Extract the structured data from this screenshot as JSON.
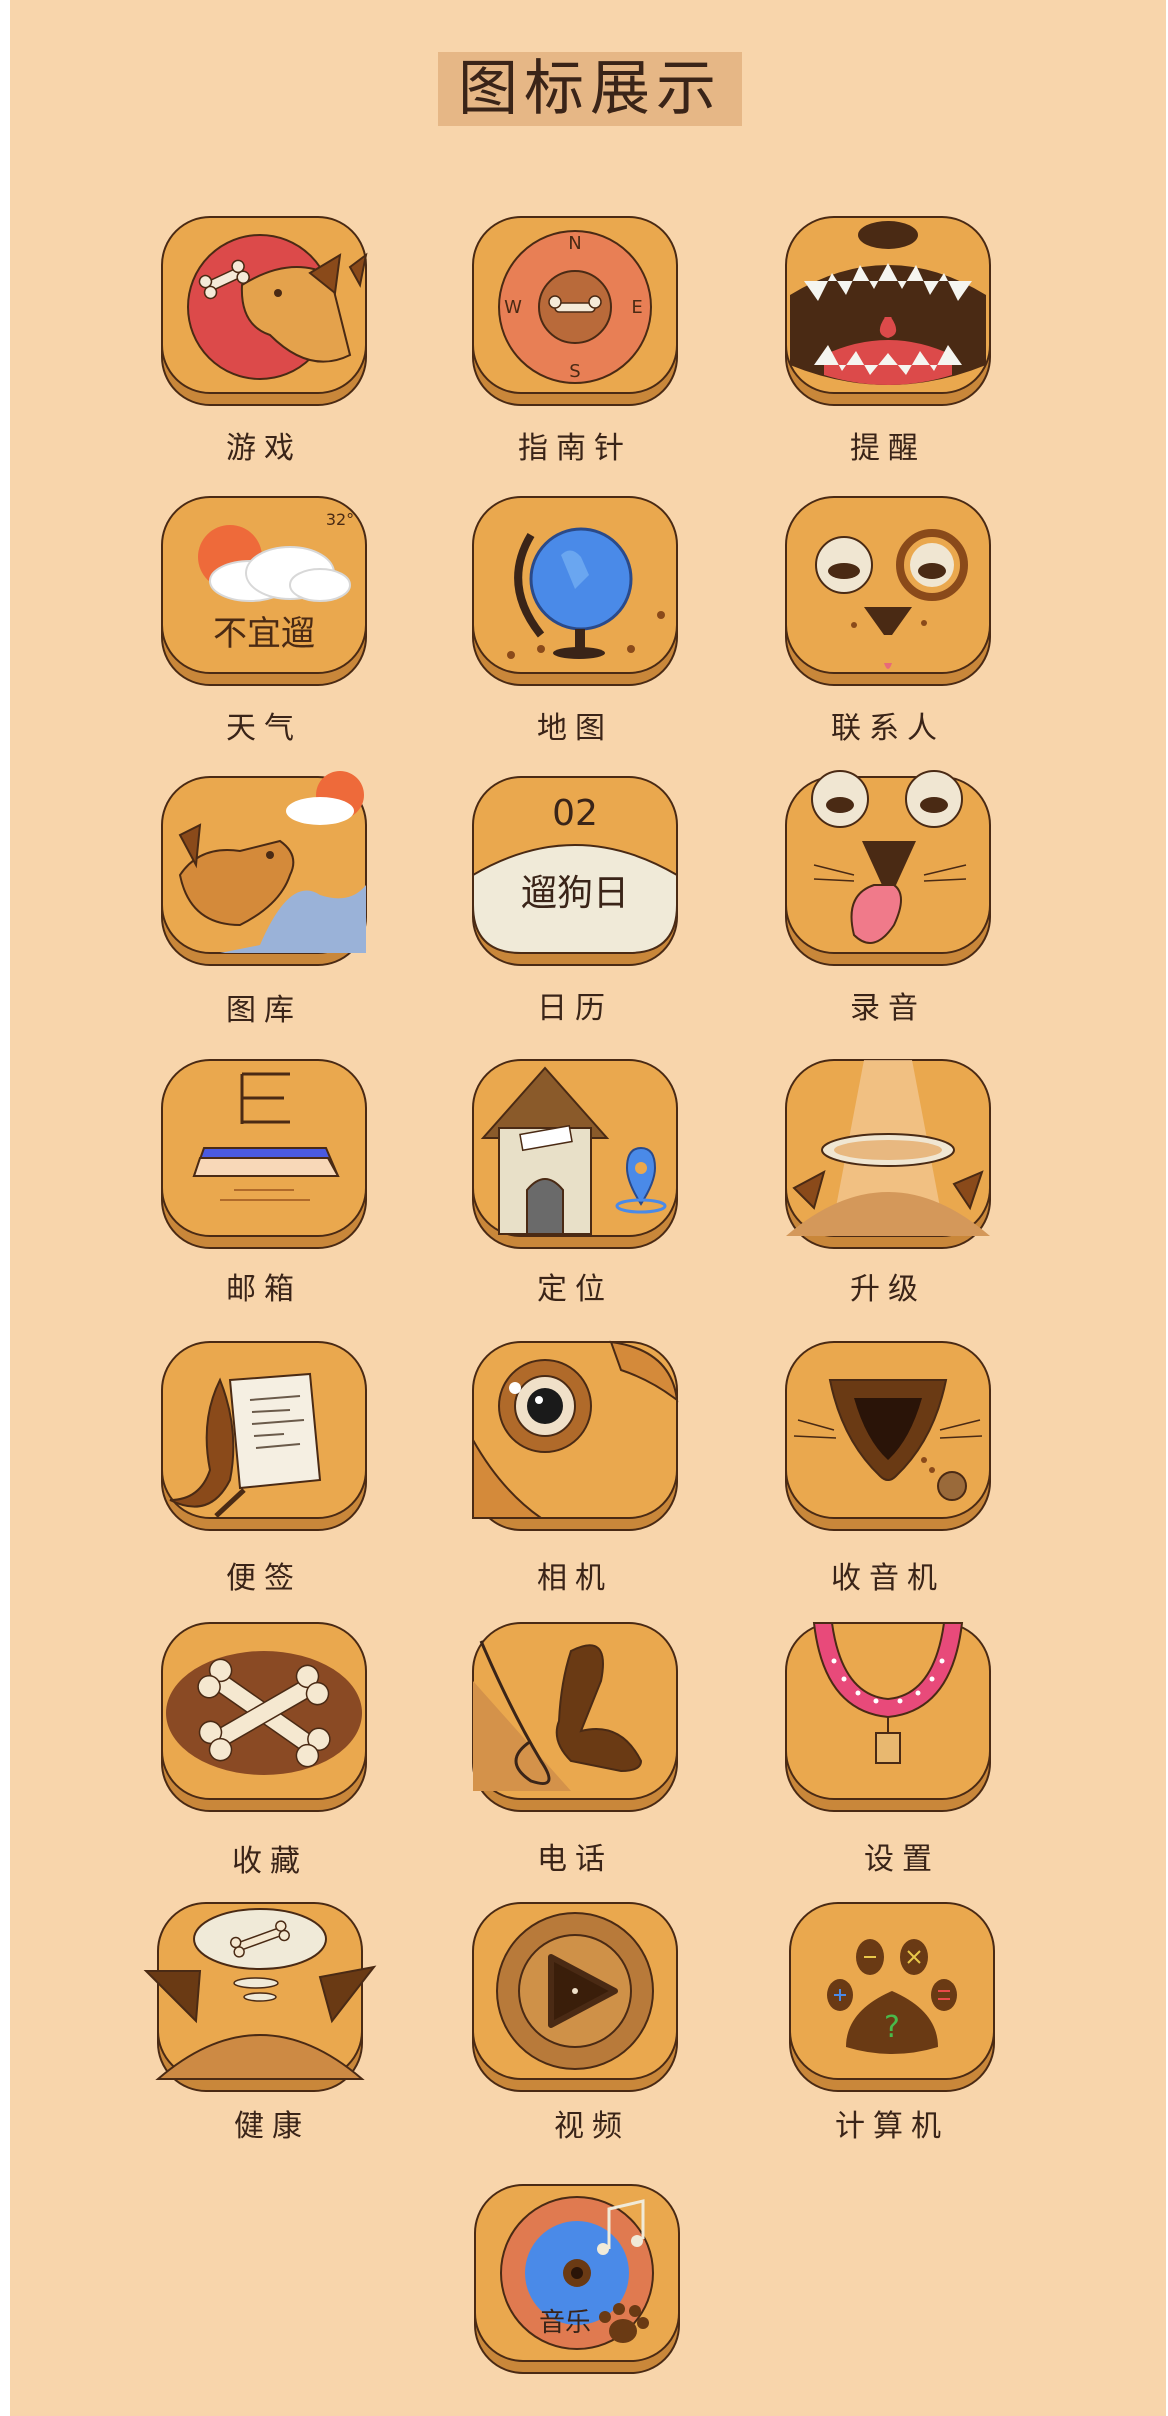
{
  "page_title": "图标展示",
  "colors": {
    "background": "#f8d5ab",
    "title_bg": "#e6b786",
    "icon_base": "#eaa84e",
    "icon_shadow": "#c9873a",
    "outline": "#4a2a14"
  },
  "icons": [
    {
      "name": "game",
      "label": "游戏",
      "icon": "dog-bone-icon"
    },
    {
      "name": "compass",
      "label": "指南针",
      "icon": "compass-icon"
    },
    {
      "name": "reminder",
      "label": "提醒",
      "icon": "teeth-mouth-icon"
    },
    {
      "name": "weather",
      "label": "天气",
      "icon": "sun-cloud-icon",
      "temp": "32°",
      "text": "不宜遛"
    },
    {
      "name": "map",
      "label": "地图",
      "icon": "globe-icon"
    },
    {
      "name": "contacts",
      "label": "联系人",
      "icon": "dog-face-icon"
    },
    {
      "name": "gallery",
      "label": "图库",
      "icon": "dog-landscape-icon"
    },
    {
      "name": "calendar",
      "label": "日历",
      "icon": "calendar-icon",
      "day": "02",
      "text": "遛狗日"
    },
    {
      "name": "recorder",
      "label": "录音",
      "icon": "tongue-face-icon"
    },
    {
      "name": "mail",
      "label": "邮箱",
      "icon": "mailbox-icon"
    },
    {
      "name": "location",
      "label": "定位",
      "icon": "doghouse-pin-icon"
    },
    {
      "name": "upgrade",
      "label": "升级",
      "icon": "halo-icon"
    },
    {
      "name": "notes",
      "label": "便签",
      "icon": "note-paper-icon"
    },
    {
      "name": "camera",
      "label": "相机",
      "icon": "camera-lens-icon"
    },
    {
      "name": "radio",
      "label": "收音机",
      "icon": "dog-nose-icon"
    },
    {
      "name": "favorites",
      "label": "收藏",
      "icon": "crossed-bones-icon"
    },
    {
      "name": "phone",
      "label": "电话",
      "icon": "phone-handset-icon"
    },
    {
      "name": "settings",
      "label": "设置",
      "icon": "dog-collar-icon"
    },
    {
      "name": "health",
      "label": "健康",
      "icon": "dream-bone-icon"
    },
    {
      "name": "video",
      "label": "视频",
      "icon": "play-button-icon"
    },
    {
      "name": "calculator",
      "label": "计算机",
      "icon": "paw-calculator-icon"
    },
    {
      "name": "music",
      "label": "音乐",
      "icon": "music-disc-icon"
    }
  ]
}
